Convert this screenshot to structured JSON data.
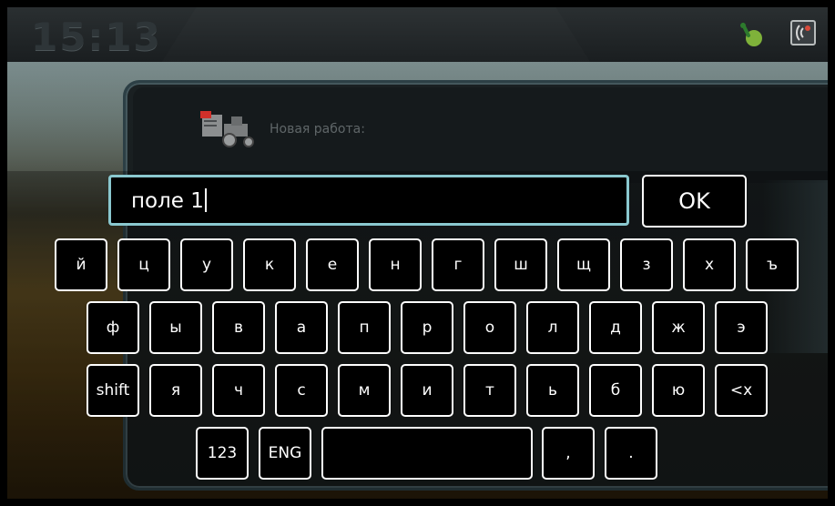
{
  "status_bar": {
    "time": "15:13",
    "gps_icon": "gps-status-icon",
    "service_icon": "service-signal-icon"
  },
  "dialog": {
    "title": "Новая работа:",
    "icon": "tractor-job-icon"
  },
  "input": {
    "value": "поле 1"
  },
  "keyboard": {
    "ok_label": "OK",
    "row1": [
      "й",
      "ц",
      "у",
      "к",
      "е",
      "н",
      "г",
      "ш",
      "щ",
      "з",
      "х",
      "ъ"
    ],
    "row2": [
      "ф",
      "ы",
      "в",
      "а",
      "п",
      "р",
      "о",
      "л",
      "д",
      "ж",
      "э"
    ],
    "row3": [
      "shift",
      "я",
      "ч",
      "с",
      "м",
      "и",
      "т",
      "ь",
      "б",
      "ю",
      "<x"
    ],
    "row4": [
      "123",
      "ENG",
      "",
      ",",
      "."
    ]
  },
  "colors": {
    "input_border": "#8ac8cf",
    "key_border": "#ffffff",
    "key_fill": "#000000"
  }
}
